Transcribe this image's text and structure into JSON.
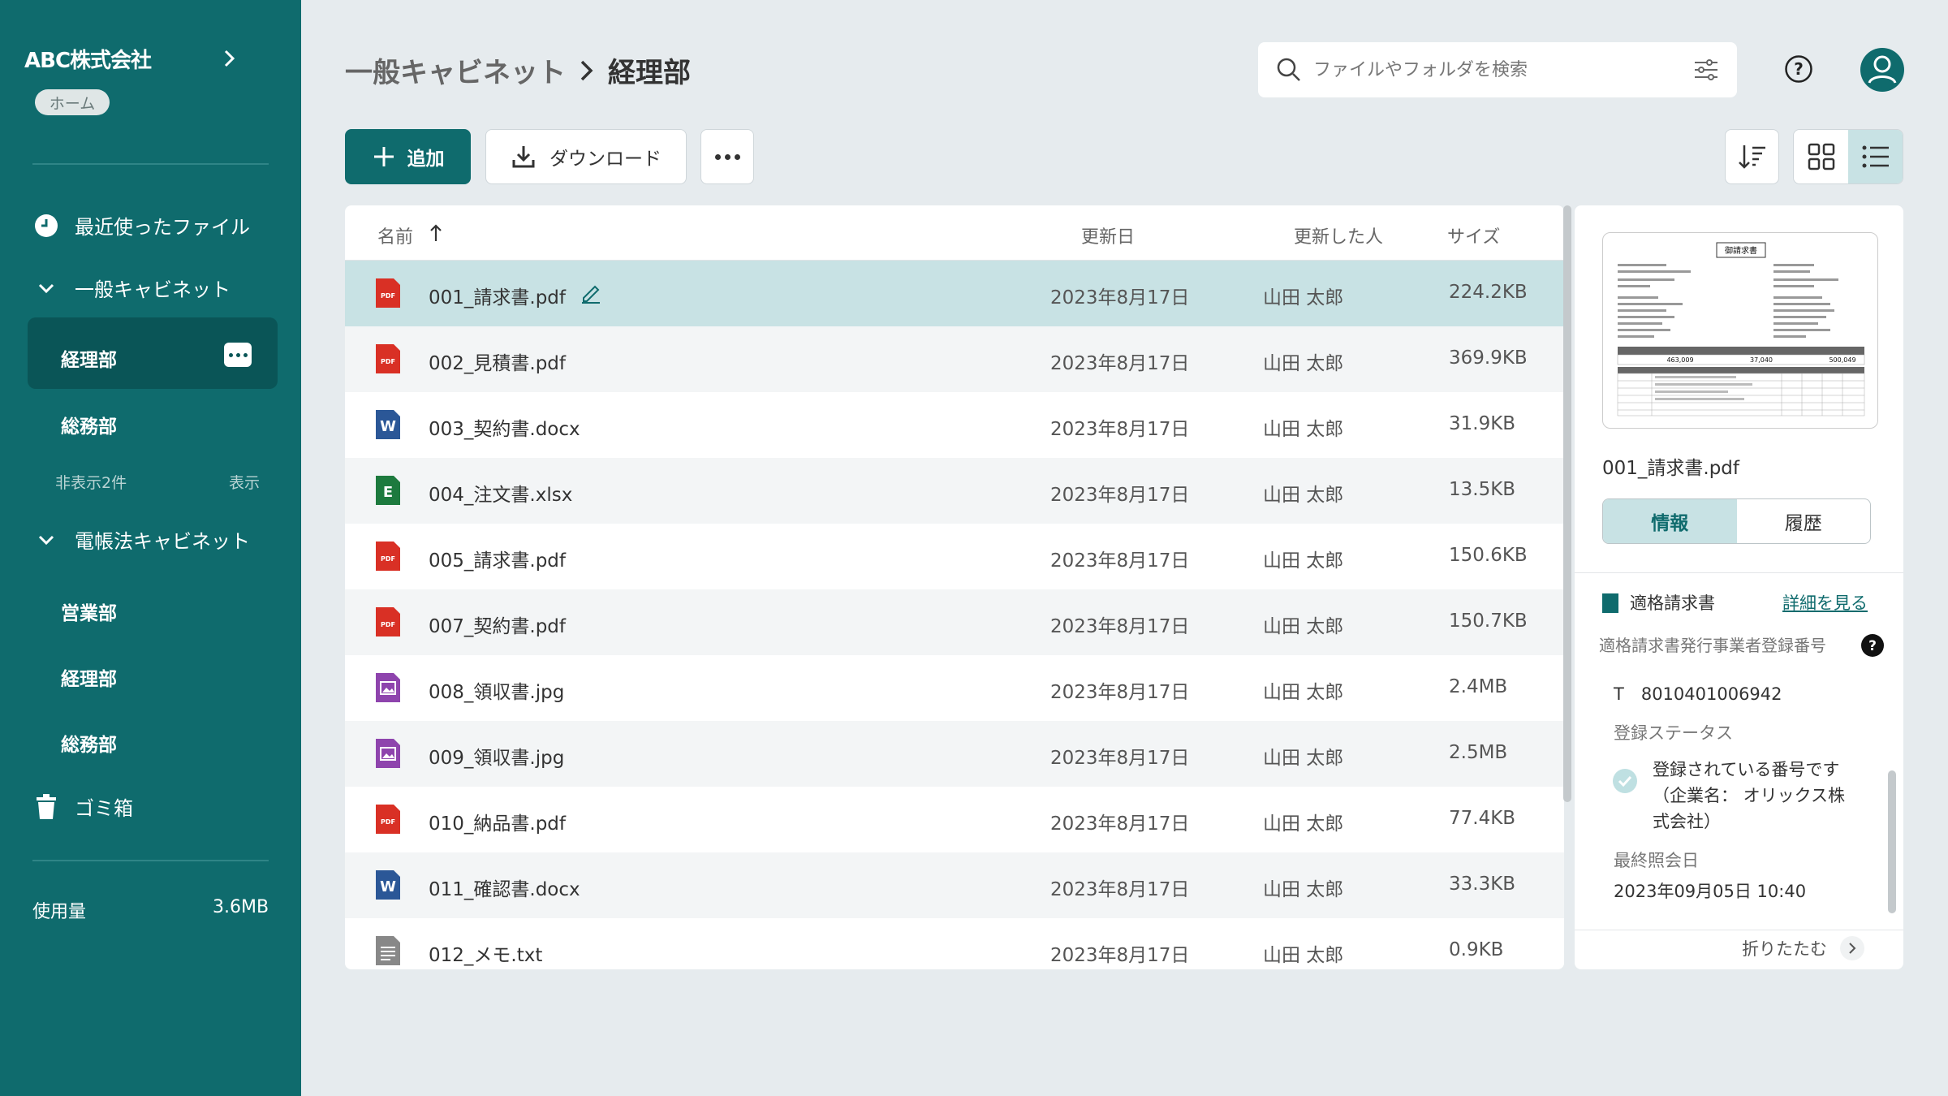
{
  "sidebar": {
    "company": "ABC株式会社",
    "home_badge": "ホーム",
    "recent": "最近使ったファイル",
    "cabinet1": {
      "label": "一般キャビネット",
      "items": [
        "経理部",
        "総務部"
      ],
      "hidden_count": "非表示2件",
      "show_label": "表示"
    },
    "cabinet2": {
      "label": "電帳法キャビネット",
      "items": [
        "営業部",
        "経理部",
        "総務部"
      ]
    },
    "trash": "ゴミ箱",
    "usage_label": "使用量",
    "usage_value": "3.6MB"
  },
  "header": {
    "breadcrumb_parent": "一般キャビネット",
    "breadcrumb_current": "経理部",
    "search_placeholder": "ファイルやフォルダを検索"
  },
  "toolbar": {
    "add_label": "追加",
    "download_label": "ダウンロード"
  },
  "table": {
    "columns": [
      "名前",
      "更新日",
      "更新した人",
      "サイズ"
    ],
    "rows": [
      {
        "name": "001_請求書.pdf",
        "type": "pdf",
        "date": "2023年8月17日",
        "user": "山田 太郎",
        "size": "224.2KB"
      },
      {
        "name": "002_見積書.pdf",
        "type": "pdf",
        "date": "2023年8月17日",
        "user": "山田 太郎",
        "size": "369.9KB"
      },
      {
        "name": "003_契約書.docx",
        "type": "word",
        "date": "2023年8月17日",
        "user": "山田 太郎",
        "size": "31.9KB"
      },
      {
        "name": "004_注文書.xlsx",
        "type": "excel",
        "date": "2023年8月17日",
        "user": "山田 太郎",
        "size": "13.5KB"
      },
      {
        "name": "005_請求書.pdf",
        "type": "pdf",
        "date": "2023年8月17日",
        "user": "山田 太郎",
        "size": "150.6KB"
      },
      {
        "name": "007_契約書.pdf",
        "type": "pdf",
        "date": "2023年8月17日",
        "user": "山田 太郎",
        "size": "150.7KB"
      },
      {
        "name": "008_領収書.jpg",
        "type": "image",
        "date": "2023年8月17日",
        "user": "山田 太郎",
        "size": "2.4MB"
      },
      {
        "name": "009_領収書.jpg",
        "type": "image",
        "date": "2023年8月17日",
        "user": "山田 太郎",
        "size": "2.5MB"
      },
      {
        "name": "010_納品書.pdf",
        "type": "pdf",
        "date": "2023年8月17日",
        "user": "山田 太郎",
        "size": "77.4KB"
      },
      {
        "name": "011_確認書.docx",
        "type": "word",
        "date": "2023年8月17日",
        "user": "山田 太郎",
        "size": "33.3KB"
      },
      {
        "name": "012_メモ.txt",
        "type": "text",
        "date": "2023年8月17日",
        "user": "山田 太郎",
        "size": "0.9KB"
      }
    ]
  },
  "panel": {
    "thumbnail": {
      "title": "御請求書",
      "amounts": [
        "463,009",
        "37,040",
        "500,049"
      ]
    },
    "file_name": "001_請求書.pdf",
    "tab_info": "情報",
    "tab_history": "履歴",
    "qualified_title": "適格請求書",
    "detail_link": "詳細を見る",
    "reg_label": "適格請求書発行事業者登録番号",
    "reg_number": "T　8010401006942",
    "status_label": "登録ステータス",
    "status_text": "登録されている番号です（企業名： オリックス株式会社）",
    "last_checked_label": "最終照会日",
    "last_checked_value": "2023年09月05日 10:40",
    "collapse_label": "折りたたむ"
  },
  "colors": {
    "brand": "#0f6b6d",
    "selected_row": "#c8e2e4",
    "pdf": "#d93025",
    "word": "#2b5797",
    "excel": "#1d7a3e",
    "image": "#8e44ad"
  }
}
